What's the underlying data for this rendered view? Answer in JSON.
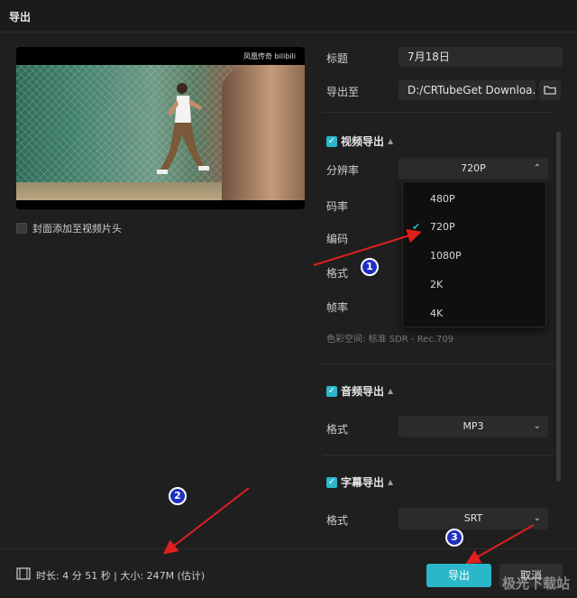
{
  "window": {
    "title": "导出"
  },
  "preview": {
    "watermark": "凤凰传奇 bilibili"
  },
  "cover_checkbox": {
    "label": "封面添加至视频片头",
    "checked": false
  },
  "fields": {
    "title_label": "标题",
    "title_value": "7月18日",
    "export_to_label": "导出至",
    "export_to_value": "D:/CRTubeGet Downloa..."
  },
  "video_export": {
    "label": "视频导出",
    "checked": true,
    "resolution_label": "分辨率",
    "resolution_value": "720P",
    "bitrate_label": "码率",
    "encoding_label": "编码",
    "format_label": "格式",
    "framerate_label": "帧率",
    "colorspace_text": "色彩空间: 标准 SDR - Rec.709",
    "resolution_options": [
      "480P",
      "720P",
      "1080P",
      "2K",
      "4K"
    ],
    "selected_option": "720P"
  },
  "audio_export": {
    "label": "音频导出",
    "checked": true,
    "format_label": "格式",
    "format_value": "MP3"
  },
  "subtitle_export": {
    "label": "字幕导出",
    "checked": true,
    "format_label": "格式",
    "format_value": "SRT"
  },
  "footer": {
    "info": "时长: 4 分 51 秒 | 大小: 247M (估计)",
    "export_button": "导出",
    "cancel_button": "取消"
  },
  "annotations": {
    "badge1": "1",
    "badge2": "2",
    "badge3": "3"
  },
  "site_logo": "极光下载站",
  "colors": {
    "accent": "#2ab7c9",
    "background": "#1f1f1f",
    "arrow": "#e0201c",
    "badge": "#1f2fbf"
  }
}
